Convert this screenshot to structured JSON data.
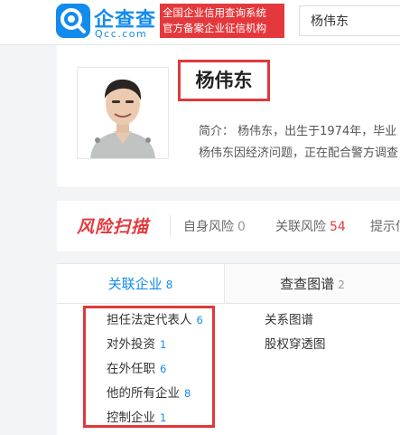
{
  "header": {
    "logo_name": "企查查",
    "logo_domain": "Qcc.com",
    "slogan_line1": "全国企业信用查询系统",
    "slogan_line2": "官方备案企业征信机构",
    "search_value": "杨伟东"
  },
  "profile": {
    "name": "杨伟东",
    "bio_line1": "简介：  杨伟东，出生于1974年，毕业",
    "bio_line2": "杨伟东因经济问题，正在配合警方调查"
  },
  "risk": {
    "logo": "风险扫描",
    "self_label": "自身风险",
    "self_count": "0",
    "related_label": "关联风险",
    "related_count": "54",
    "hint_label": "提示信"
  },
  "tabs": [
    {
      "label": "关联企业",
      "count": "8"
    },
    {
      "label": "查查图谱",
      "count": "2"
    }
  ],
  "sub_items": [
    {
      "label": "担任法定代表人",
      "count": "6"
    },
    {
      "label": "对外投资",
      "count": "1"
    },
    {
      "label": "在外任职",
      "count": "6"
    },
    {
      "label": "他的所有企业",
      "count": "8"
    },
    {
      "label": "控制企业",
      "count": "1"
    }
  ],
  "right_items": [
    {
      "label": "关系图谱"
    },
    {
      "label": "股权穿透图"
    }
  ],
  "colors": {
    "brand_blue": "#128bed",
    "highlight_red": "#e0393a",
    "slogan_red": "#e4393c"
  }
}
